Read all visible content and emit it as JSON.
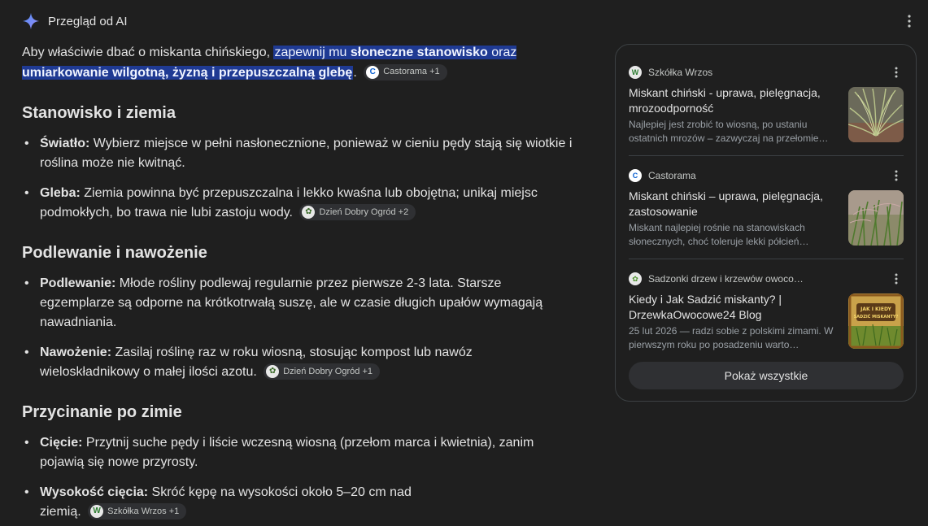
{
  "header": {
    "title": "Przegląd od AI"
  },
  "intro": {
    "prefix": "Aby właściwie dbać o miskanta chińskiego, ",
    "hl1": "zapewnij mu ",
    "hl2": "słoneczne stanowisko",
    "hl3": " oraz ",
    "hl4": "umiarkowanie wilgotną, żyzną i przepuszczalną glebę",
    "suffix": ".",
    "chip": "Castorama +1"
  },
  "sections": [
    {
      "heading": "Stanowisko i ziemia",
      "items": [
        {
          "term": "Światło:",
          "text": " Wybierz miejsce w pełni nasłonecznione, ponieważ w cieniu pędy stają się wiotkie i roślina może nie kwitnąć."
        },
        {
          "term": "Gleba:",
          "text": " Ziemia powinna być przepuszczalna i lekko kwaśna lub obojętna; unikaj miejsc podmokłych, bo trawa nie lubi zastoju wody.",
          "chip": "Dzień Dobry Ogród +2"
        }
      ]
    },
    {
      "heading": "Podlewanie i nawożenie",
      "items": [
        {
          "term": "Podlewanie:",
          "text": " Młode rośliny podlewaj regularnie przez pierwsze 2-3 lata. Starsze egzemplarze są odporne na krótkotrwałą suszę, ale w czasie długich upałów wymagają nawadniania."
        },
        {
          "term": "Nawożenie:",
          "text": " Zasilaj roślinę raz w roku wiosną, stosując kompost lub nawóz wieloskładnikowy o małej ilości azotu.",
          "chip": "Dzień Dobry Ogród +1"
        }
      ]
    },
    {
      "heading": "Przycinanie po zimie",
      "items": [
        {
          "term": "Cięcie:",
          "text": " Przytnij suche pędy i liście wczesną wiosną (przełom marca i kwietnia), zanim pojawią się nowe przyrosty."
        },
        {
          "term": "Wysokość cięcia:",
          "text": " Skróć kępę na wysokości około 5–20 cm nad ziemią.",
          "chip": "Szkółka Wrzos +1"
        }
      ]
    }
  ],
  "sources": [
    {
      "name": "Szkółka Wrzos",
      "title": "Miskant chiński - uprawa, pielęgnacja, mrozoodporność",
      "snippet": "Najlepiej jest zrobić to wiosną, po ustaniu ostatnich mrozów – zazwyczaj na przełomie…"
    },
    {
      "name": "Castorama",
      "title": "Miskant chiński – uprawa, pielęgnacja, zastosowanie",
      "snippet": "Miskant najlepiej rośnie na stanowiskach słonecznych, choć toleruje lekki półcień…"
    },
    {
      "name": "Sadzonki drzew i krzewów owoco…",
      "title": "Kiedy i Jak Sadzić miskanty? | DrzewkaOwocowe24 Blog",
      "snippet": "25 lut 2026 — radzi sobie z polskimi zimami. W pierwszym roku po posadzeniu warto…"
    }
  ],
  "show_all": "Pokaż wszystkie",
  "thumb3_text": {
    "line1": "JAK I KIEDY",
    "line2": "SADZIĆ MISKANTY?"
  },
  "colors": {
    "background": "#1f1f1f",
    "highlight": "#1f3a93",
    "chip": "#2f3033",
    "border": "#3c4043"
  }
}
